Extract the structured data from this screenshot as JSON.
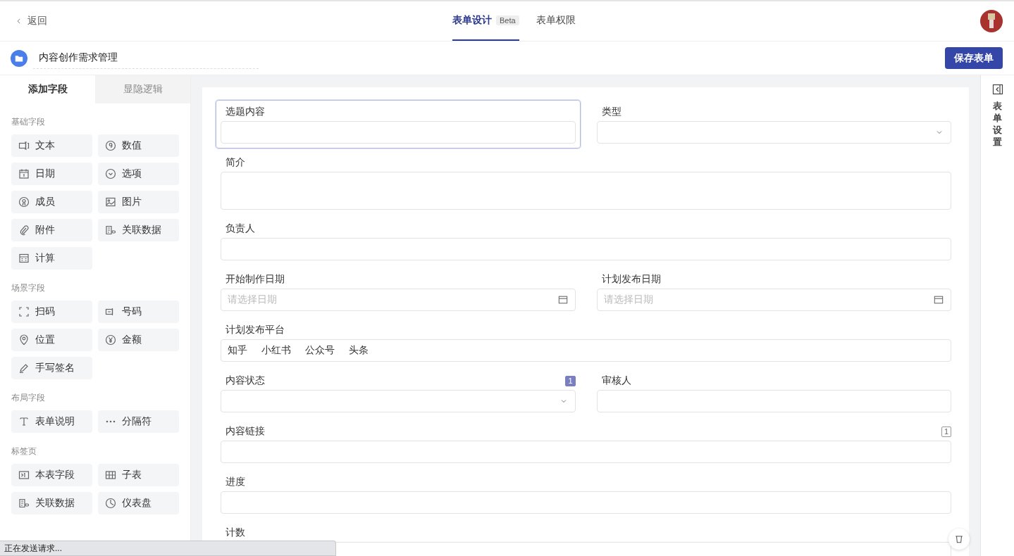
{
  "topbar": {
    "back": "返回",
    "tabs": [
      {
        "label": "表单设计",
        "badge": "Beta",
        "selected": true
      },
      {
        "label": "表单权限",
        "selected": false
      }
    ]
  },
  "header": {
    "title": "内容创作需求管理",
    "save": "保存表单"
  },
  "sidebar": {
    "tabs": [
      {
        "label": "添加字段",
        "selected": true
      },
      {
        "label": "显隐逻辑",
        "selected": false
      }
    ],
    "groups": [
      {
        "title": "基础字段",
        "items": [
          {
            "label": "文本",
            "kind": "text"
          },
          {
            "label": "数值",
            "kind": "number"
          },
          {
            "label": "日期",
            "kind": "date"
          },
          {
            "label": "选项",
            "kind": "option"
          },
          {
            "label": "成员",
            "kind": "member"
          },
          {
            "label": "图片",
            "kind": "image"
          },
          {
            "label": "附件",
            "kind": "attach"
          },
          {
            "label": "关联数据",
            "kind": "link"
          },
          {
            "label": "计算",
            "kind": "calc"
          }
        ]
      },
      {
        "title": "场景字段",
        "items": [
          {
            "label": "扫码",
            "kind": "scan"
          },
          {
            "label": "号码",
            "kind": "code"
          },
          {
            "label": "位置",
            "kind": "location"
          },
          {
            "label": "金额",
            "kind": "money"
          },
          {
            "label": "手写签名",
            "kind": "sign"
          }
        ]
      },
      {
        "title": "布局字段",
        "items": [
          {
            "label": "表单说明",
            "kind": "textnote"
          },
          {
            "label": "分隔符",
            "kind": "divider"
          }
        ]
      },
      {
        "title": "标签页",
        "items": [
          {
            "label": "本表字段",
            "kind": "tabfield"
          },
          {
            "label": "子表",
            "kind": "table"
          },
          {
            "label": "关联数据",
            "kind": "link"
          },
          {
            "label": "仪表盘",
            "kind": "dashboard"
          }
        ]
      }
    ]
  },
  "form": {
    "rows": [
      [
        {
          "label": "选题内容",
          "kind": "text",
          "selected": true
        },
        {
          "label": "类型",
          "kind": "select",
          "selected": false
        }
      ],
      [
        {
          "label": "简介",
          "kind": "textarea",
          "selected": false
        }
      ],
      [
        {
          "label": "负责人",
          "kind": "text",
          "selected": false
        }
      ],
      [
        {
          "label": "开始制作日期",
          "kind": "date",
          "placeholder": "请选择日期",
          "selected": false
        },
        {
          "label": "计划发布日期",
          "kind": "date",
          "placeholder": "请选择日期",
          "selected": false
        }
      ],
      [
        {
          "label": "计划发布平台",
          "kind": "options",
          "options": [
            "知乎",
            "小红书",
            "公众号",
            "头条"
          ],
          "selected": false
        }
      ],
      [
        {
          "label": "内容状态",
          "kind": "select",
          "badge": {
            "text": "1",
            "filled": true
          },
          "selected": false
        },
        {
          "label": "审核人",
          "kind": "text",
          "selected": false
        }
      ],
      [
        {
          "label": "内容链接",
          "kind": "text",
          "badge": {
            "text": "1",
            "filled": false
          },
          "selected": false
        }
      ],
      [
        {
          "label": "进度",
          "kind": "text",
          "selected": false
        }
      ],
      [
        {
          "label": "计数",
          "kind": "text",
          "selected": false
        }
      ]
    ]
  },
  "settings_panel": {
    "label": "表单设置"
  },
  "status_bar": "正在发送请求..."
}
